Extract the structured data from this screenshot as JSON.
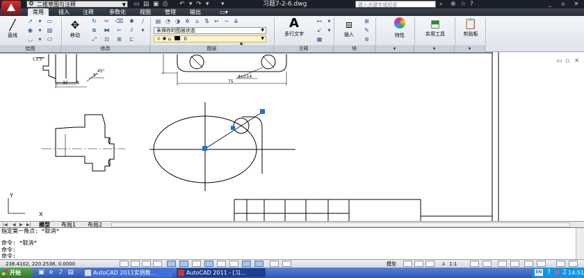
{
  "titlebar": {
    "workspace": "二维草图与注释",
    "document_title": "习题7-2-6.dwg",
    "help_search_placeholder": "键入关键字或短语"
  },
  "ribbon_tabs": [
    "常用",
    "插入",
    "注释",
    "参数化",
    "视图",
    "管理",
    "输出"
  ],
  "ribbon": {
    "draw": {
      "line_label": "直线",
      "panel_label": "绘图"
    },
    "modify": {
      "move_label": "移动",
      "panel_label": "修改"
    },
    "layers": {
      "layer_state": "未保存的图层状态",
      "current_layer": "0",
      "panel_label": "图层"
    },
    "annotation": {
      "mtext_label": "多行文字",
      "panel_label": "注释"
    },
    "block": {
      "insert_label": "插入",
      "panel_label": "块"
    },
    "properties": {
      "label": "特性"
    },
    "utilities": {
      "label": "实用工具"
    },
    "clipboard": {
      "label": "剪贴板"
    }
  },
  "drawing": {
    "dim_c15": "C1.5",
    "dim_slope": "5°",
    "dim_45": "45°",
    "dim_32": "32",
    "dim_8": "8",
    "dim_holes": "4x∅14",
    "dim_75": "75",
    "ucs_y": "Y",
    "ucs_x": "X"
  },
  "layout_tabs": [
    "模型",
    "布局1",
    "布局2"
  ],
  "command_line": {
    "lines": [
      "指定第一角点: *取消*",
      "命令: *取消*",
      "命令:",
      "命令:"
    ]
  },
  "statusbar": {
    "coords": "238.4102, 220.2538, 0.0000",
    "model_label": "模型",
    "anno_scale": "1:1"
  },
  "taskbar": {
    "start_label": "开始",
    "tasks": [
      "AutoCAD 2011实例教...",
      "AutoCAD 2011 - [习..."
    ],
    "lang": "EN",
    "clock": "14:51"
  },
  "colors": {
    "title_bg": "#1b1f27",
    "ribbon_bg": "#e8ecf2",
    "grip": "#1e6fe0",
    "taskbar": "#2d56b8"
  }
}
